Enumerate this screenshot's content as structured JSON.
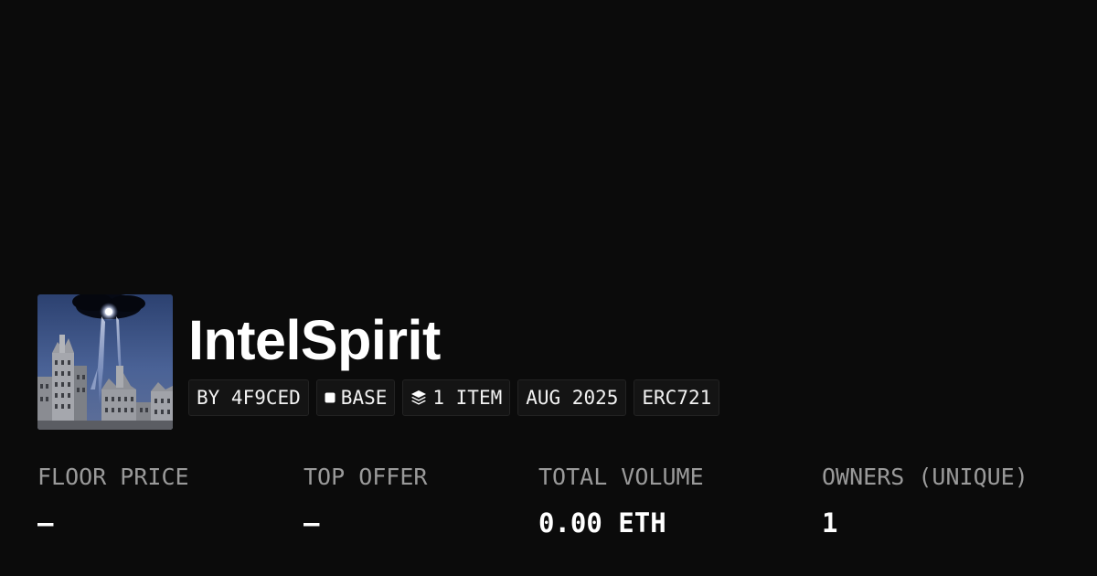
{
  "collection": {
    "name": "IntelSpirit",
    "image_icon": "collection-thumbnail-city-beam"
  },
  "chips": [
    {
      "label": "BY 4F9CED"
    },
    {
      "label": "BASE",
      "icon": "square-chain-icon"
    },
    {
      "label": "1 ITEM",
      "icon": "layers-icon"
    },
    {
      "label": "AUG 2025"
    },
    {
      "label": "ERC721"
    }
  ],
  "stats": [
    {
      "label": "FLOOR PRICE",
      "value": "–"
    },
    {
      "label": "TOP OFFER",
      "value": "–"
    },
    {
      "label": "TOTAL VOLUME",
      "value": "0.00 ETH"
    },
    {
      "label": "OWNERS (UNIQUE)",
      "value": "1"
    }
  ],
  "colors": {
    "background": "#0b0b0b",
    "text": "#ffffff",
    "muted": "#9a9a9a",
    "chip_bg": "#141414",
    "chip_border": "#232323"
  }
}
